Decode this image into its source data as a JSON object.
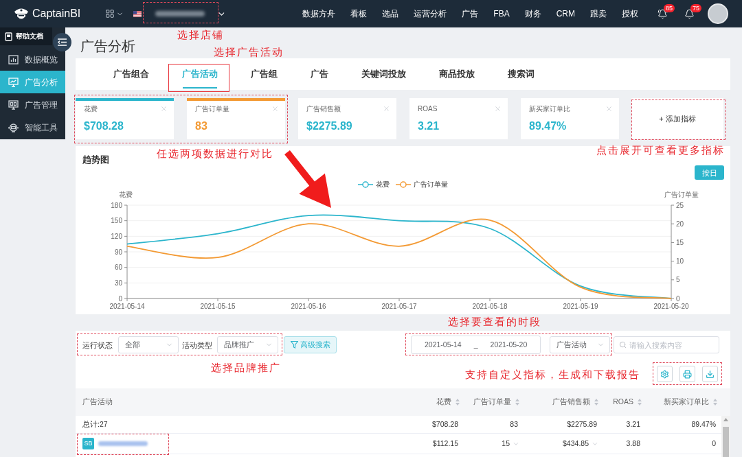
{
  "header": {
    "logo": "CaptainBI",
    "nav": [
      "数据方舟",
      "看板",
      "选品",
      "运营分析",
      "广告",
      "FBA",
      "财务",
      "CRM",
      "跟卖",
      "授权"
    ],
    "badges": [
      "85",
      "75"
    ]
  },
  "sidebar": {
    "help": "帮助文档",
    "items": [
      {
        "label": "数据概览",
        "selected": false
      },
      {
        "label": "广告分析",
        "selected": true
      },
      {
        "label": "广告管理",
        "selected": false
      },
      {
        "label": "智能工具",
        "selected": false
      }
    ]
  },
  "page_title": "广告分析",
  "tabs": [
    {
      "label": "广告组合",
      "selected": false
    },
    {
      "label": "广告活动",
      "selected": true
    },
    {
      "label": "广告组",
      "selected": false
    },
    {
      "label": "广告",
      "selected": false
    },
    {
      "label": "关键词投放",
      "selected": false
    },
    {
      "label": "商品投放",
      "selected": false
    },
    {
      "label": "搜索词",
      "selected": false
    }
  ],
  "metrics": [
    {
      "label": "花费",
      "value": "$708.28",
      "selected": true,
      "color": "#2bb5cc"
    },
    {
      "label": "广告订单量",
      "value": "83",
      "selected": true,
      "color": "#f39a34"
    },
    {
      "label": "广告销售额",
      "value": "$2275.89",
      "selected": false,
      "color": "#2bb5cc"
    },
    {
      "label": "ROAS",
      "value": "3.21",
      "selected": false,
      "color": "#2bb5cc"
    },
    {
      "label": "新买家订单比",
      "value": "89.47%",
      "selected": false,
      "color": "#2bb5cc"
    }
  ],
  "add_metric": "+ 添加指标",
  "trend": {
    "title": "趋势图",
    "toggle": "按日",
    "chart_data": {
      "type": "line",
      "legend": "top",
      "grid": true,
      "ylabel": "花费",
      "y2label": "广告订单量",
      "categories": [
        "2021-05-14",
        "2021-05-15",
        "2021-05-16",
        "2021-05-17",
        "2021-05-18",
        "2021-05-19",
        "2021-05-20"
      ],
      "series": [
        {
          "name": "花费",
          "color": "#2bb5cc",
          "values": [
            105,
            125,
            160,
            150,
            135,
            24,
            0
          ]
        },
        {
          "name": "广告订单量",
          "color": "#f39a34",
          "axis": "y2",
          "values": [
            14,
            11,
            20,
            14,
            21,
            3,
            0
          ]
        }
      ],
      "ylim": [
        0,
        180
      ],
      "yticks": [
        0,
        30,
        60,
        90,
        120,
        150,
        180
      ],
      "y2lim": [
        0,
        25
      ],
      "y2ticks": [
        0,
        5,
        10,
        15,
        20,
        25
      ]
    }
  },
  "filters": {
    "status_label": "运行状态",
    "status_value": "全部",
    "type_label": "活动类型",
    "type_value": "品牌推广",
    "advanced_search": "高级搜索",
    "date_from": "2021-05-14",
    "date_separator": "_",
    "date_to": "2021-05-20",
    "scope": "广告活动",
    "search_placeholder": "请输入搜索内容"
  },
  "table": {
    "columns": [
      "广告活动",
      "花费",
      "广告订单量",
      "广告销售额",
      "ROAS",
      "新买家订单比"
    ],
    "rows": [
      {
        "cells": [
          {
            "kind": "text",
            "text": "总计:27"
          },
          {
            "kind": "text",
            "text": "$708.28"
          },
          {
            "kind": "text",
            "text": "83"
          },
          {
            "kind": "text",
            "text": "$2275.89"
          },
          {
            "kind": "text",
            "text": "3.21"
          },
          {
            "kind": "text",
            "text": "89.47%"
          }
        ]
      },
      {
        "cells": [
          {
            "kind": "campaign",
            "badge": "SB"
          },
          {
            "kind": "text",
            "text": "$112.15"
          },
          {
            "kind": "dropdown",
            "text": "15"
          },
          {
            "kind": "dropdown",
            "text": "$434.85"
          },
          {
            "kind": "text",
            "text": "3.88"
          },
          {
            "kind": "text",
            "text": "0"
          }
        ]
      }
    ]
  },
  "annotations": [
    "选择店铺",
    "选择广告活动",
    "任选两项数据进行对比",
    "点击展开可查看更多指标",
    "选择要查看的时段",
    "选择品牌推广",
    "支持自定义指标，生成和下载报告"
  ]
}
